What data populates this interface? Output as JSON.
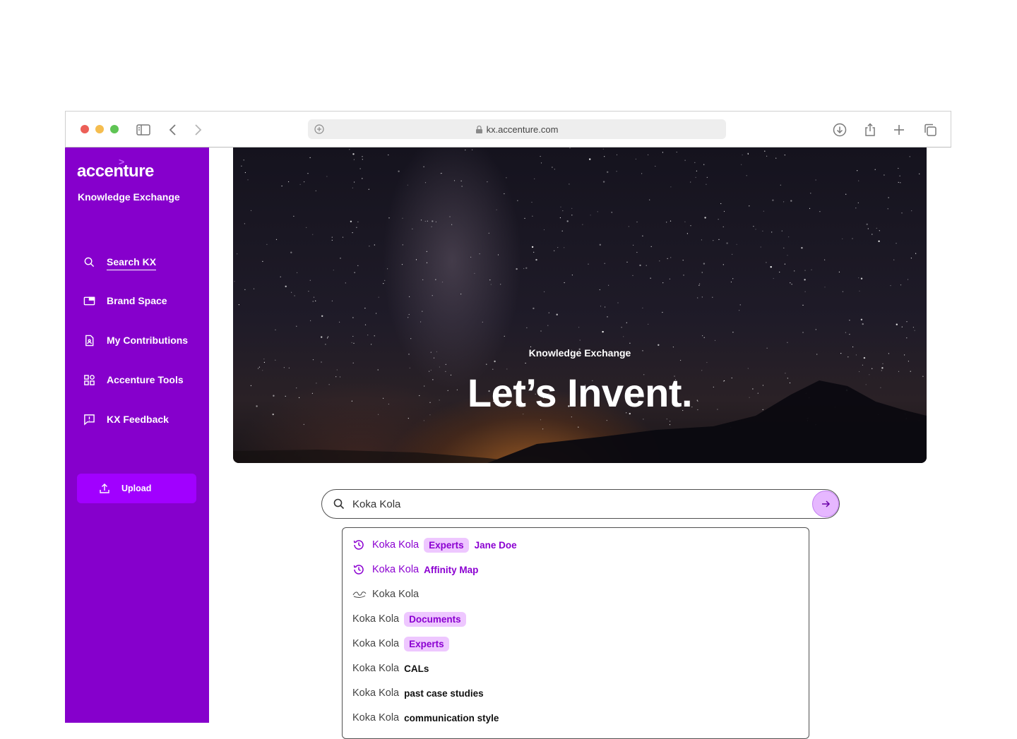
{
  "browser": {
    "url": "kx.accenture.com"
  },
  "sidebar": {
    "logo": "accenture",
    "logo_mark": ">",
    "site_name": "Knowledge Exchange",
    "items": [
      {
        "label": "Search KX",
        "icon": "search-icon",
        "active": true
      },
      {
        "label": "Brand Space",
        "icon": "folder-icon"
      },
      {
        "label": "My Contributions",
        "icon": "document-user-icon"
      },
      {
        "label": "Accenture Tools",
        "icon": "grid-tools-icon"
      },
      {
        "label": "KX Feedback",
        "icon": "feedback-icon"
      }
    ],
    "upload_label": "Upload"
  },
  "hero": {
    "kicker": "Knowledge Exchange",
    "title": "Let’s Invent."
  },
  "search": {
    "value": "Koka Kola",
    "suggestions": [
      {
        "icon": "history-icon",
        "query": "Koka Kola",
        "pill": "Experts",
        "tail": "Jane Doe"
      },
      {
        "icon": "history-icon",
        "query": "Koka Kola",
        "tail": "Affinity Map"
      },
      {
        "icon": "brand-logo-icon",
        "query": "Koka Kola"
      },
      {
        "query": "Koka Kola",
        "pill": "Documents"
      },
      {
        "query": "Koka Kola",
        "pill": "Experts"
      },
      {
        "query": "Koka Kola",
        "tail": "CALs"
      },
      {
        "query": "Koka Kola",
        "tail": "past case studies"
      },
      {
        "query": "Koka Kola",
        "tail": "communication style"
      }
    ]
  },
  "colors": {
    "brand_purple": "#8600cc",
    "accent_purple": "#a100ff",
    "pill_bg": "#eec7ff"
  }
}
